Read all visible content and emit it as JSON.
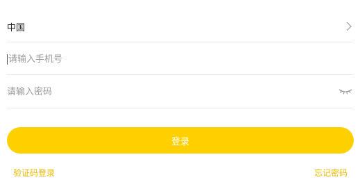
{
  "region": {
    "label": "中国",
    "icon": "chevron-right-icon"
  },
  "phone": {
    "placeholder": "请输入手机号",
    "value": ""
  },
  "password": {
    "placeholder": "请输入密码",
    "value": "",
    "toggle_icon": "eye-closed-icon"
  },
  "actions": {
    "login_label": "登录",
    "sms_login_label": "验证码登录",
    "forgot_password_label": "忘记密码"
  },
  "colors": {
    "accent": "#ffd000",
    "link": "#e6b800",
    "divider": "#e8e8e8",
    "placeholder": "#9a9a9a"
  }
}
